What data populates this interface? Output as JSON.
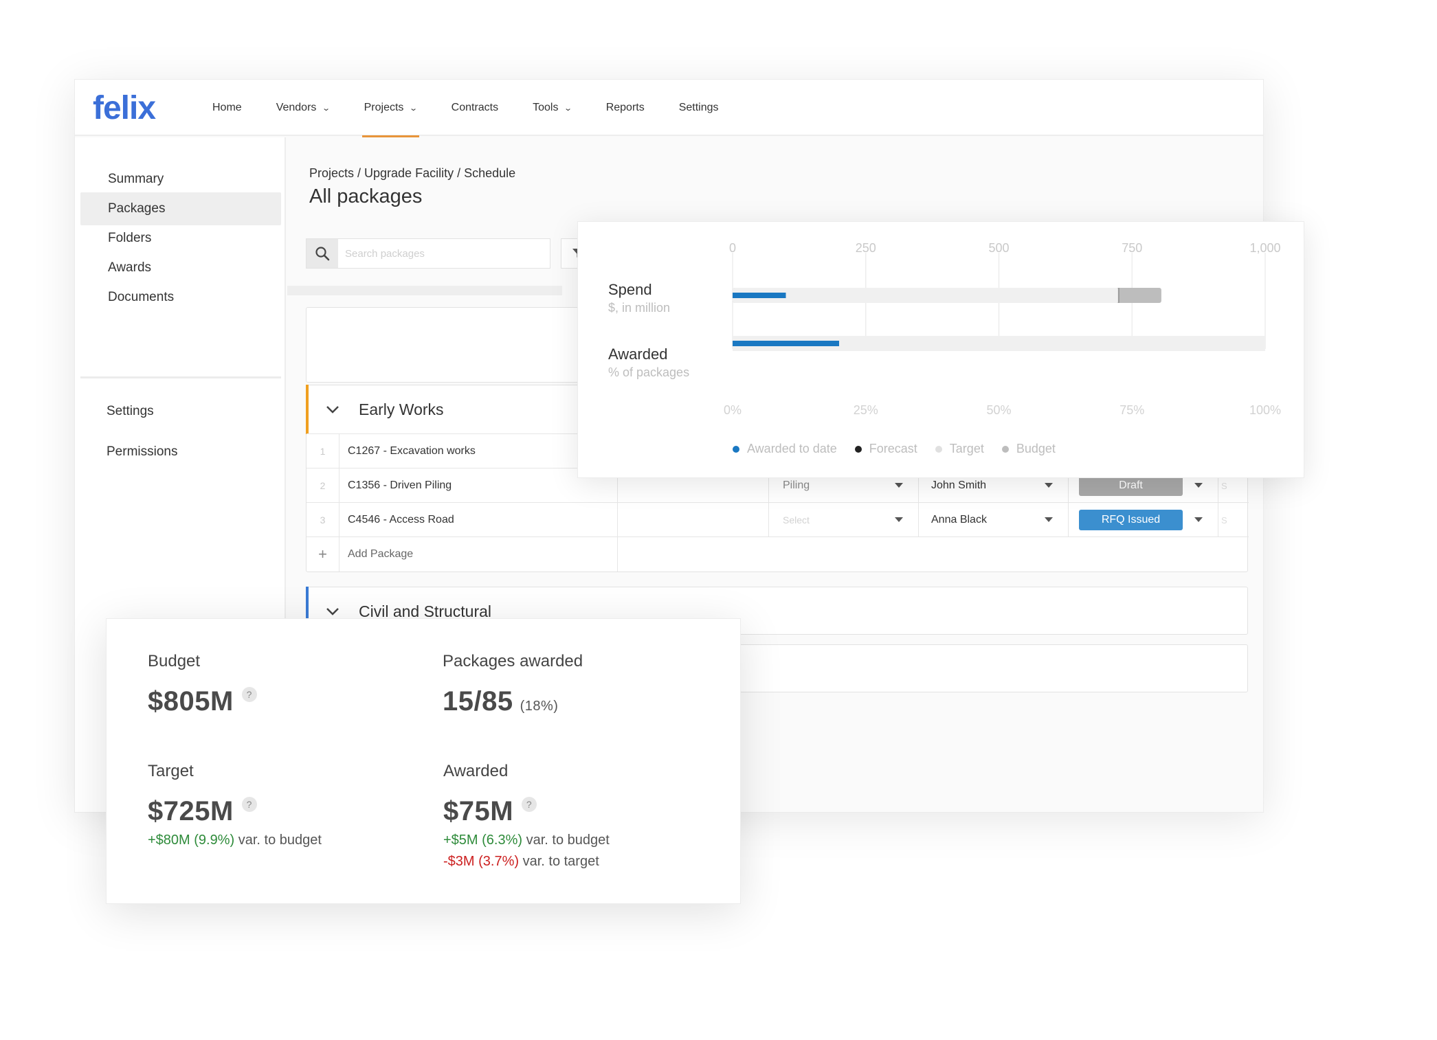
{
  "app": {
    "logo": "felix",
    "nav": [
      {
        "label": "Home",
        "dropdown": false,
        "active": false
      },
      {
        "label": "Vendors",
        "dropdown": true,
        "active": false
      },
      {
        "label": "Projects",
        "dropdown": true,
        "active": true
      },
      {
        "label": "Contracts",
        "dropdown": false,
        "active": false
      },
      {
        "label": "Tools",
        "dropdown": true,
        "active": false
      },
      {
        "label": "Reports",
        "dropdown": false,
        "active": false
      },
      {
        "label": "Settings",
        "dropdown": false,
        "active": false
      }
    ],
    "active_accent": "#e8953a"
  },
  "sidebar": {
    "items": [
      {
        "label": "Summary"
      },
      {
        "label": "Packages",
        "active": true
      },
      {
        "label": "Folders"
      },
      {
        "label": "Awards"
      },
      {
        "label": "Documents"
      }
    ],
    "items_secondary": [
      {
        "label": "Settings"
      },
      {
        "label": "Permissions"
      }
    ]
  },
  "main": {
    "breadcrumb": "Projects / Upgrade Facility / Schedule",
    "title": "All packages",
    "search_placeholder": "Search packages",
    "groups": [
      {
        "name": "Early Works",
        "accent": "#f0a020"
      },
      {
        "name": "Civil and Structural",
        "accent": "#3a7bd5"
      }
    ],
    "packages": [
      {
        "num": "1",
        "name": "C1267 -  Excavation works",
        "category": "",
        "person": "",
        "status": ""
      },
      {
        "num": "2",
        "name": "C1356 - Driven Piling",
        "category": "Piling",
        "category_placeholder": false,
        "person": "John Smith",
        "status": "Draft",
        "status_color": "#a8a8a8",
        "extra": "S"
      },
      {
        "num": "3",
        "name": "C4546 - Access Road",
        "category": "Select",
        "category_placeholder": true,
        "person": "Anna Black",
        "status": "RFQ Issued",
        "status_color": "#3b8fcf",
        "extra": "S"
      }
    ],
    "add_package": {
      "icon": "+",
      "label": "Add Package"
    }
  },
  "chart_data": {
    "type": "bar",
    "orientation": "horizontal",
    "rows": [
      {
        "label": "Spend",
        "sublabel": "$, in million",
        "axis_ticks": [
          "0",
          "250",
          "500",
          "750",
          "1,000"
        ],
        "xlim": [
          0,
          1000
        ],
        "awarded_to_date": 100,
        "target": 725,
        "budget": 805
      },
      {
        "label": "Awarded",
        "sublabel": "% of packages",
        "axis_ticks": [
          "0%",
          "25%",
          "50%",
          "75%",
          "100%"
        ],
        "xlim": [
          0,
          100
        ],
        "awarded_to_date": 20,
        "track": 100
      }
    ],
    "legend": [
      {
        "label": "Awarded to date",
        "color": "#1a78c2"
      },
      {
        "label": "Forecast",
        "color": "#222222"
      },
      {
        "label": "Target",
        "color": "#e0e0e0"
      },
      {
        "label": "Budget",
        "color": "#bdbdbd"
      }
    ],
    "grid": true
  },
  "stats": {
    "budget": {
      "label": "Budget",
      "value": "$805M",
      "help_icon": "?"
    },
    "packages_awarded": {
      "label": "Packages awarded",
      "value": "15/85",
      "pct": "(18%)"
    },
    "target": {
      "label": "Target",
      "value": "$725M",
      "help_icon": "?",
      "var_value": "+$80M (9.9%)",
      "var_text": " var. to budget"
    },
    "awarded": {
      "label": "Awarded",
      "value": "$75M",
      "help_icon": "?",
      "var1_value": "+$5M (6.3%)",
      "var1_text": " var. to budget",
      "var2_value": "-$3M (3.7%)",
      "var2_text": " var. to target"
    }
  }
}
